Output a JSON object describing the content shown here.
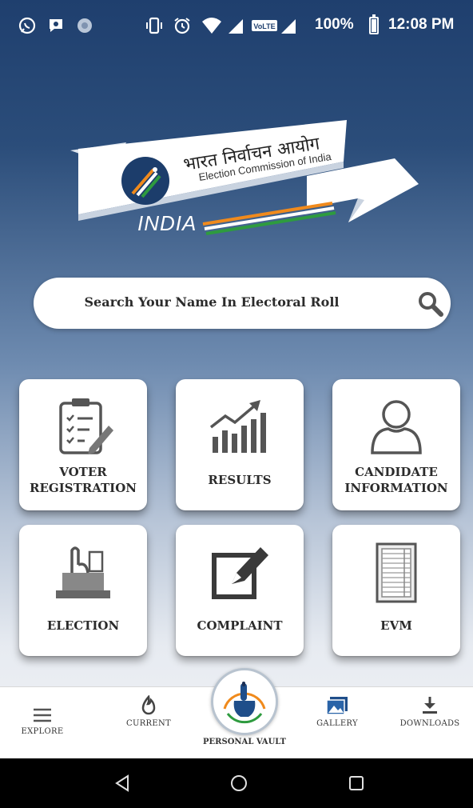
{
  "status_bar": {
    "battery_percent": "100%",
    "time": "12:08 PM",
    "icons": [
      "whatsapp-icon",
      "chat-icon",
      "app-icon",
      "vibrate-icon",
      "alarm-icon",
      "wifi-icon",
      "signal-icon",
      "volte-icon",
      "signal-icon",
      "battery-icon"
    ]
  },
  "logo": {
    "hindi_text": "भारत निर्वाचन आयोग",
    "english_text": "Election Commission of India",
    "country_text": "INDIA"
  },
  "search": {
    "placeholder": "Search Your Name In Electoral Roll",
    "icon": "search-icon"
  },
  "tiles": [
    {
      "line1": "VOTER",
      "line2": "REGISTRATION",
      "icon": "clipboard-icon"
    },
    {
      "line1": "RESULTS",
      "line2": "",
      "icon": "bar-chart-icon"
    },
    {
      "line1": "CANDIDATE",
      "line2": "INFORMATION",
      "icon": "person-icon"
    },
    {
      "line1": "ELECTION",
      "line2": "",
      "icon": "ballot-box-icon"
    },
    {
      "line1": "COMPLAINT",
      "line2": "",
      "icon": "edit-icon"
    },
    {
      "line1": "EVM",
      "line2": "",
      "icon": "evm-icon"
    }
  ],
  "bottom_nav": {
    "items": [
      {
        "label": "EXPLORE",
        "icon": "menu-icon"
      },
      {
        "label": "CURRENT",
        "icon": "flame-icon"
      },
      {
        "label": "PERSONAL VAULT",
        "icon": "voting-finger-icon"
      },
      {
        "label": "GALLERY",
        "icon": "gallery-icon"
      },
      {
        "label": "DOWNLOADS",
        "icon": "download-icon"
      }
    ]
  },
  "colors": {
    "header_blue": "#1f3f6e",
    "tile_bg": "#ffffff",
    "text_dark": "#2b2b2b",
    "accent_orange": "#f08a1c",
    "accent_green": "#2e9b3f"
  }
}
